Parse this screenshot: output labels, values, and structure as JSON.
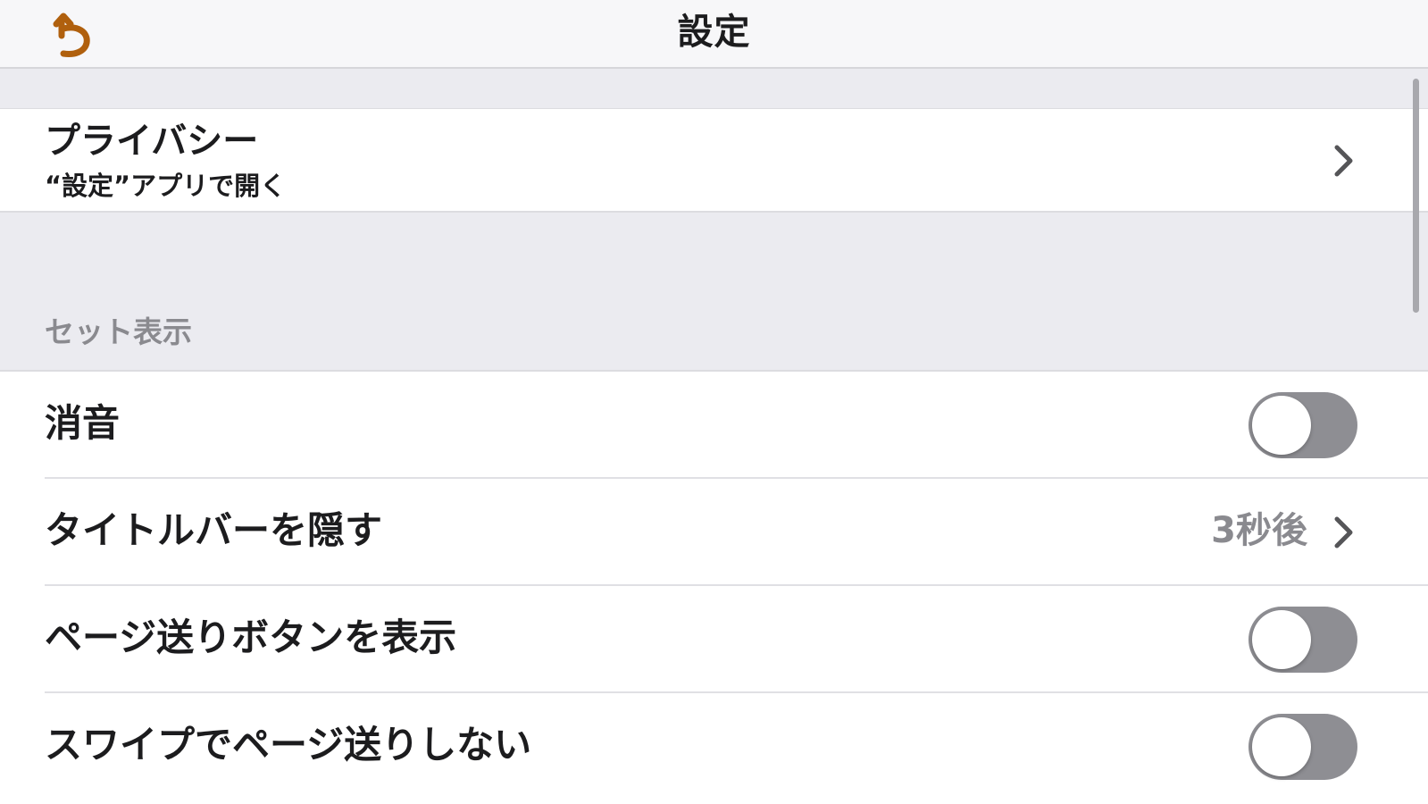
{
  "nav": {
    "title": "設定",
    "back_icon": "undo-arrow-icon",
    "accent_color": "#b0600e"
  },
  "privacy": {
    "title": "プライバシー",
    "subtitle": "“設定”アプリで開く"
  },
  "section": {
    "header": "セット表示"
  },
  "settings": {
    "mute": {
      "label": "消音",
      "on": false
    },
    "hide_titlebar": {
      "label": "タイトルバーを隠す",
      "value": "3秒後"
    },
    "page_buttons": {
      "label": "ページ送りボタンを表示",
      "on": false
    },
    "no_swipe": {
      "label": "スワイプでページ送りしない",
      "on": false
    }
  }
}
